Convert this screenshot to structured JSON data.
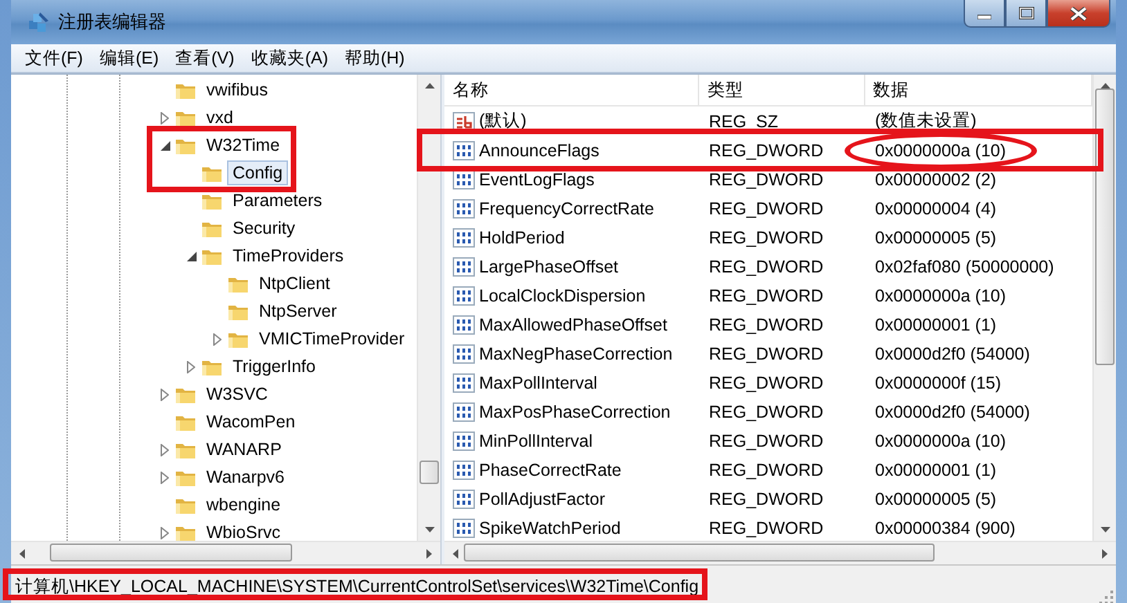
{
  "window": {
    "title": "注册表编辑器"
  },
  "menu": [
    "文件(F)",
    "编辑(E)",
    "查看(V)",
    "收藏夹(A)",
    "帮助(H)"
  ],
  "tree": [
    {
      "label": "vwifibus",
      "kind": "leaf",
      "selected": false,
      "marked": false
    },
    {
      "label": "vxd",
      "kind": "collapsed",
      "selected": false,
      "marked": false
    },
    {
      "label": "W32Time",
      "kind": "expanded",
      "selected": false,
      "marked": true,
      "children": [
        {
          "label": "Config",
          "kind": "leaf",
          "selected": true,
          "marked": true
        },
        {
          "label": "Parameters",
          "kind": "leaf",
          "selected": false,
          "marked": false
        },
        {
          "label": "Security",
          "kind": "leaf",
          "selected": false,
          "marked": false
        },
        {
          "label": "TimeProviders",
          "kind": "expanded",
          "selected": false,
          "marked": false,
          "children": [
            {
              "label": "NtpClient",
              "kind": "leaf",
              "selected": false,
              "marked": false
            },
            {
              "label": "NtpServer",
              "kind": "leaf",
              "selected": false,
              "marked": false
            },
            {
              "label": "VMICTimeProvider",
              "kind": "collapsed",
              "selected": false,
              "marked": false
            }
          ]
        },
        {
          "label": "TriggerInfo",
          "kind": "collapsed",
          "selected": false,
          "marked": false
        }
      ]
    },
    {
      "label": "W3SVC",
      "kind": "collapsed",
      "selected": false,
      "marked": false
    },
    {
      "label": "WacomPen",
      "kind": "leaf",
      "selected": false,
      "marked": false
    },
    {
      "label": "WANARP",
      "kind": "collapsed",
      "selected": false,
      "marked": false
    },
    {
      "label": "Wanarpv6",
      "kind": "collapsed",
      "selected": false,
      "marked": false
    },
    {
      "label": "wbengine",
      "kind": "leaf",
      "selected": false,
      "marked": false
    },
    {
      "label": "WbioSrvc",
      "kind": "collapsed",
      "selected": false,
      "marked": false
    }
  ],
  "values": {
    "columns": [
      "名称",
      "类型",
      "数据"
    ],
    "rows": [
      {
        "kind": "string",
        "name": "(默认)",
        "type": "REG_SZ",
        "data": "(数值未设置)",
        "marked": false
      },
      {
        "kind": "dword",
        "name": "AnnounceFlags",
        "type": "REG_DWORD",
        "data": "0x0000000a (10)",
        "marked": true
      },
      {
        "kind": "dword",
        "name": "EventLogFlags",
        "type": "REG_DWORD",
        "data": "0x00000002 (2)",
        "marked": false
      },
      {
        "kind": "dword",
        "name": "FrequencyCorrectRate",
        "type": "REG_DWORD",
        "data": "0x00000004 (4)",
        "marked": false
      },
      {
        "kind": "dword",
        "name": "HoldPeriod",
        "type": "REG_DWORD",
        "data": "0x00000005 (5)",
        "marked": false
      },
      {
        "kind": "dword",
        "name": "LargePhaseOffset",
        "type": "REG_DWORD",
        "data": "0x02faf080 (50000000)",
        "marked": false
      },
      {
        "kind": "dword",
        "name": "LocalClockDispersion",
        "type": "REG_DWORD",
        "data": "0x0000000a (10)",
        "marked": false
      },
      {
        "kind": "dword",
        "name": "MaxAllowedPhaseOffset",
        "type": "REG_DWORD",
        "data": "0x00000001 (1)",
        "marked": false
      },
      {
        "kind": "dword",
        "name": "MaxNegPhaseCorrection",
        "type": "REG_DWORD",
        "data": "0x0000d2f0 (54000)",
        "marked": false
      },
      {
        "kind": "dword",
        "name": "MaxPollInterval",
        "type": "REG_DWORD",
        "data": "0x0000000f (15)",
        "marked": false
      },
      {
        "kind": "dword",
        "name": "MaxPosPhaseCorrection",
        "type": "REG_DWORD",
        "data": "0x0000d2f0 (54000)",
        "marked": false
      },
      {
        "kind": "dword",
        "name": "MinPollInterval",
        "type": "REG_DWORD",
        "data": "0x0000000a (10)",
        "marked": false
      },
      {
        "kind": "dword",
        "name": "PhaseCorrectRate",
        "type": "REG_DWORD",
        "data": "0x00000001 (1)",
        "marked": false
      },
      {
        "kind": "dword",
        "name": "PollAdjustFactor",
        "type": "REG_DWORD",
        "data": "0x00000005 (5)",
        "marked": false
      },
      {
        "kind": "dword",
        "name": "SpikeWatchPeriod",
        "type": "REG_DWORD",
        "data": "0x00000384 (900)",
        "marked": false
      }
    ]
  },
  "status_bar": {
    "path": "计算机\\HKEY_LOCAL_MACHINE\\SYSTEM\\CurrentControlSet\\services\\W32Time\\Config",
    "marked": true
  }
}
